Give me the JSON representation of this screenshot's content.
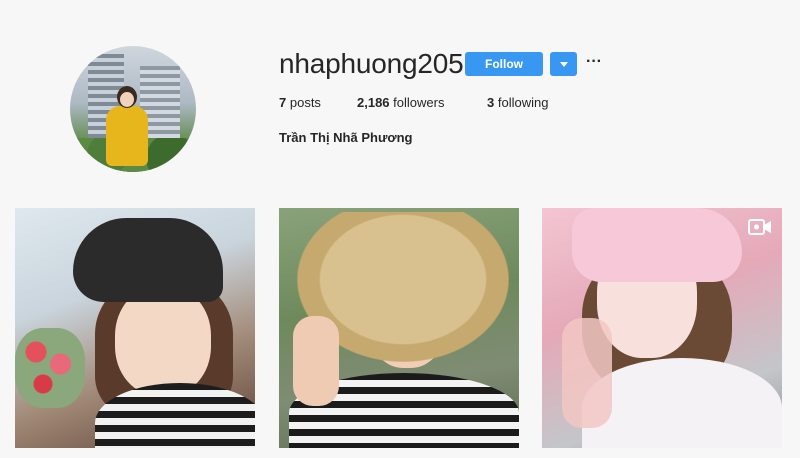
{
  "profile": {
    "username": "nhaphuong205",
    "follow_label": "Follow",
    "full_name": "Trần Thị Nhã Phương",
    "stats": {
      "posts_count": "7",
      "posts_label": "posts",
      "followers_count": "2,186",
      "followers_label": "followers",
      "following_count": "3",
      "following_label": "following"
    }
  },
  "posts": [
    {
      "kind": "photo",
      "icon": null
    },
    {
      "kind": "photo",
      "icon": null
    },
    {
      "kind": "video",
      "icon": "video-camera-icon"
    }
  ],
  "colors": {
    "accent": "#3897f0",
    "background": "#f7f7f7",
    "text": "#262626"
  }
}
